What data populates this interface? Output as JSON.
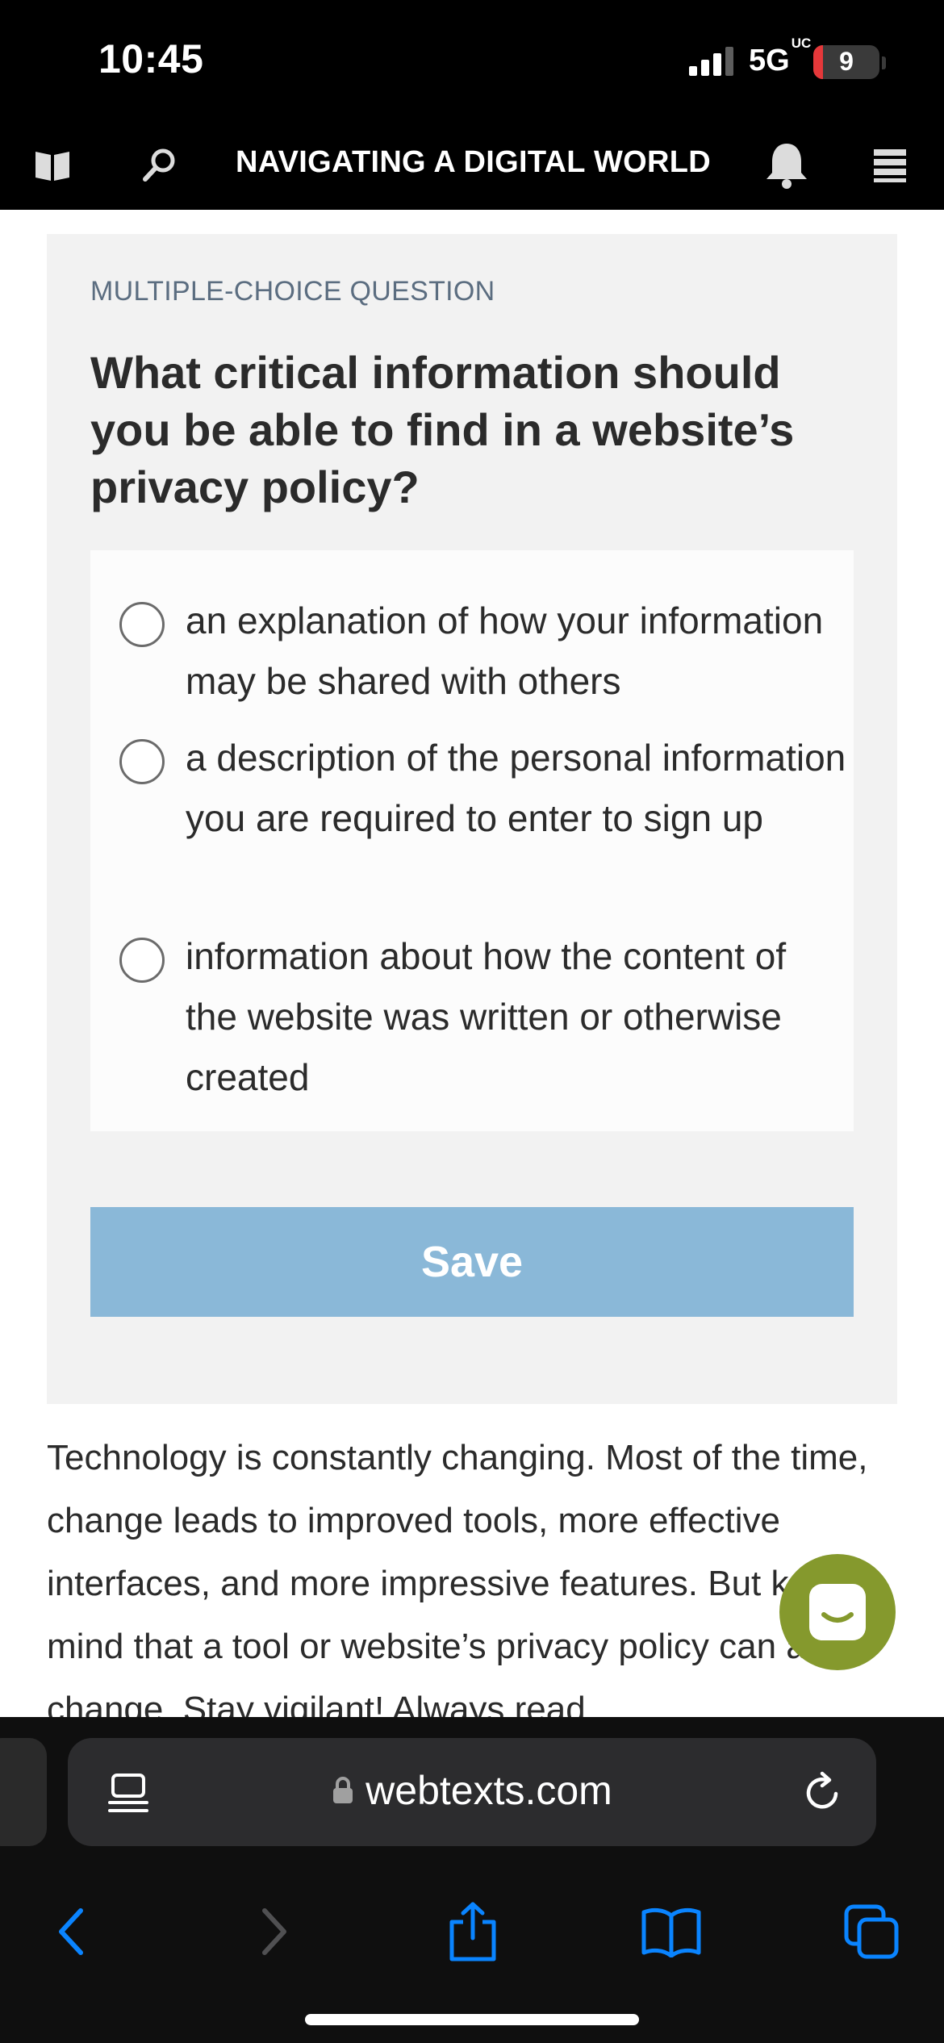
{
  "status_bar": {
    "time": "10:45",
    "network": "5G",
    "network_suffix": "UC",
    "battery": "9"
  },
  "app_header": {
    "title": "NAVIGATING A DIGITAL WORLD",
    "icons": [
      "book-icon",
      "search-icon",
      "bell-icon",
      "menu-icon"
    ]
  },
  "quiz": {
    "kicker": "MULTIPLE-CHOICE QUESTION",
    "question": "What critical information should you be able to find in a website’s privacy policy?",
    "options": [
      {
        "label": "an explanation of how your information may be shared with others",
        "selected": false
      },
      {
        "label": "a description of the personal information you are required to enter to sign up",
        "selected": false
      },
      {
        "label": "information about how the content of the website was written or otherwise created",
        "selected": false
      }
    ],
    "save_label": "Save"
  },
  "body": {
    "paragraph": "Technology is constantly changing. Most of the time, change leads to improved tools, more effective interfaces, and more impressive features. But keep in mind that a tool or website’s privacy policy can also change. Stay vigilant! Always read"
  },
  "browser": {
    "url": "webtexts.com",
    "toolbar_icons": [
      "back-icon",
      "forward-icon",
      "share-icon",
      "bookmarks-icon",
      "tabs-icon"
    ]
  },
  "colors": {
    "chrome": "#000000",
    "card_bg": "#f2f2f2",
    "save_button": "#8ab8d8",
    "chat_button": "#85992d",
    "ios_blue": "#0a84ff"
  }
}
